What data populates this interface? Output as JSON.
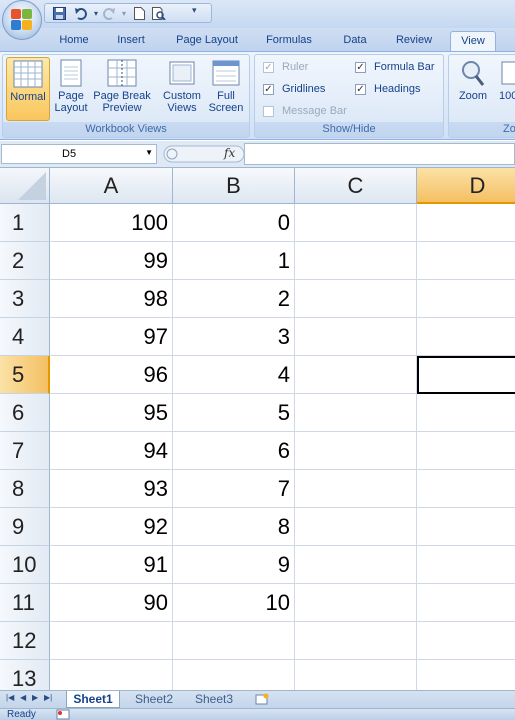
{
  "qat": {
    "items": [
      "save-icon",
      "undo-icon",
      "redo-icon",
      "new-icon",
      "print-preview-icon"
    ]
  },
  "tabs": [
    "Home",
    "Insert",
    "Page Layout",
    "Formulas",
    "Data",
    "Review",
    "View"
  ],
  "active_tab": "View",
  "ribbon": {
    "workbook_views": {
      "label": "Workbook Views",
      "normal": "Normal",
      "page_layout_1": "Page",
      "page_layout_2": "Layout",
      "page_break_1": "Page Break",
      "page_break_2": "Preview",
      "custom_1": "Custom",
      "custom_2": "Views",
      "full_1": "Full",
      "full_2": "Screen"
    },
    "show_hide": {
      "label": "Show/Hide",
      "ruler": "Ruler",
      "gridlines": "Gridlines",
      "message_bar": "Message Bar",
      "formula_bar": "Formula Bar",
      "headings": "Headings"
    },
    "zoom": {
      "zoom": "Zoom",
      "hundred": "100",
      "group_label": "Zo"
    }
  },
  "formula_bar": {
    "name_box": "D5",
    "fx": "fx",
    "value": ""
  },
  "columns": [
    "A",
    "B",
    "C",
    "D"
  ],
  "rows": [
    {
      "n": "1",
      "a": "100",
      "b": "0"
    },
    {
      "n": "2",
      "a": "99",
      "b": "1"
    },
    {
      "n": "3",
      "a": "98",
      "b": "2"
    },
    {
      "n": "4",
      "a": "97",
      "b": "3"
    },
    {
      "n": "5",
      "a": "96",
      "b": "4"
    },
    {
      "n": "6",
      "a": "95",
      "b": "5"
    },
    {
      "n": "7",
      "a": "94",
      "b": "6"
    },
    {
      "n": "8",
      "a": "93",
      "b": "7"
    },
    {
      "n": "9",
      "a": "92",
      "b": "8"
    },
    {
      "n": "10",
      "a": "91",
      "b": "9"
    },
    {
      "n": "11",
      "a": "90",
      "b": "10"
    },
    {
      "n": "12",
      "a": "",
      "b": ""
    },
    {
      "n": "13",
      "a": "",
      "b": ""
    }
  ],
  "sheets": [
    "Sheet1",
    "Sheet2",
    "Sheet3"
  ],
  "active_sheet": "Sheet1",
  "status": {
    "text": "Ready"
  },
  "colors": {
    "accent": "#15428b",
    "selected_header": "#f4c063",
    "ribbon": "#dde9f8"
  }
}
